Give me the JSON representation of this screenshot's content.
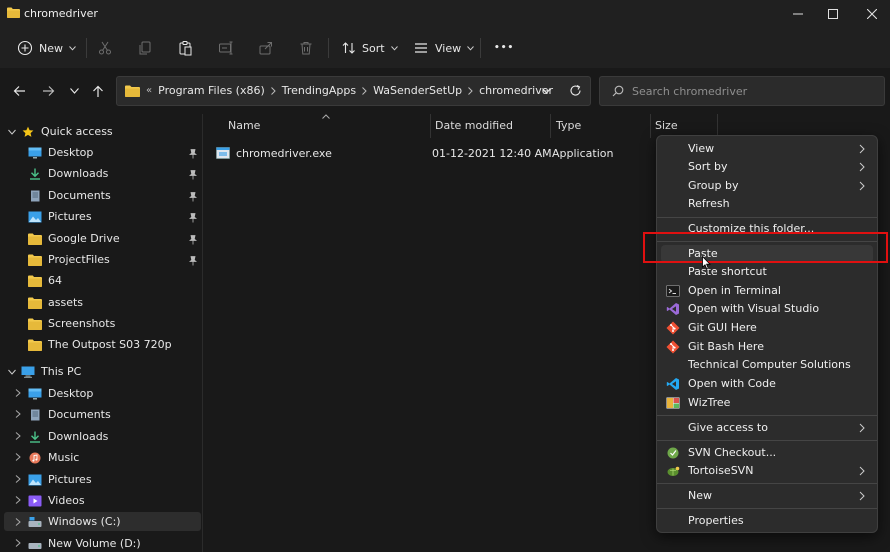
{
  "window": {
    "title": "chromedriver",
    "minimize_glyph": "—",
    "maximize_glyph": "☐",
    "close_glyph": "✕"
  },
  "commandbar": {
    "new_label": "New",
    "sort_label": "Sort",
    "view_label": "View",
    "more_glyph": "•••"
  },
  "address": {
    "overflow": "«",
    "crumbs": [
      "Program Files (x86)",
      "TrendingApps",
      "WaSenderSetUp",
      "chromedriver"
    ]
  },
  "search": {
    "placeholder": "Search chromedriver"
  },
  "sidebar": {
    "quick_access": "Quick access",
    "quick_items": [
      {
        "label": "Desktop",
        "icon": "desktop-icon",
        "pinned": true
      },
      {
        "label": "Downloads",
        "icon": "download-icon",
        "pinned": true
      },
      {
        "label": "Documents",
        "icon": "documents-icon",
        "pinned": true
      },
      {
        "label": "Pictures",
        "icon": "pictures-icon",
        "pinned": true
      },
      {
        "label": "Google Drive",
        "icon": "folder-icon",
        "pinned": true
      },
      {
        "label": "ProjectFiles",
        "icon": "folder-icon",
        "pinned": true
      },
      {
        "label": "64",
        "icon": "folder-icon",
        "pinned": false
      },
      {
        "label": "assets",
        "icon": "folder-icon",
        "pinned": false
      },
      {
        "label": "Screenshots",
        "icon": "folder-icon",
        "pinned": false
      },
      {
        "label": "The Outpost S03 720p",
        "icon": "folder-icon",
        "pinned": false
      }
    ],
    "this_pc": "This PC",
    "pc_items": [
      {
        "label": "Desktop",
        "icon": "desktop-icon"
      },
      {
        "label": "Documents",
        "icon": "documents-icon"
      },
      {
        "label": "Downloads",
        "icon": "download-icon"
      },
      {
        "label": "Music",
        "icon": "music-icon"
      },
      {
        "label": "Pictures",
        "icon": "pictures-icon"
      },
      {
        "label": "Videos",
        "icon": "videos-icon"
      },
      {
        "label": "Windows (C:)",
        "icon": "drive-icon"
      },
      {
        "label": "New Volume (D:)",
        "icon": "drive-icon"
      }
    ]
  },
  "filelist": {
    "columns": {
      "name": "Name",
      "date": "Date modified",
      "type": "Type",
      "size": "Size"
    },
    "files": [
      {
        "name": "chromedriver.exe",
        "date": "01-12-2021 12:40 AM",
        "type": "Application"
      }
    ]
  },
  "context_menu": {
    "items": [
      {
        "label": "View",
        "submenu": true
      },
      {
        "label": "Sort by",
        "submenu": true
      },
      {
        "label": "Group by",
        "submenu": true
      },
      {
        "label": "Refresh",
        "submenu": false
      },
      {
        "label": "Customize this folder...",
        "submenu": false
      },
      {
        "label": "Paste",
        "submenu": false
      },
      {
        "label": "Paste shortcut",
        "submenu": false
      },
      {
        "label": "Open in Terminal",
        "submenu": false,
        "icon": "terminal-icon"
      },
      {
        "label": "Open with Visual Studio",
        "submenu": false,
        "icon": "visual-studio-icon"
      },
      {
        "label": "Git GUI Here",
        "submenu": false,
        "icon": "git-icon"
      },
      {
        "label": "Git Bash Here",
        "submenu": false,
        "icon": "git-icon"
      },
      {
        "label": "Technical Computer Solutions",
        "submenu": false
      },
      {
        "label": "Open with Code",
        "submenu": false,
        "icon": "vscode-icon"
      },
      {
        "label": "WizTree",
        "submenu": false,
        "icon": "wiztree-icon"
      },
      {
        "label": "Give access to",
        "submenu": true
      },
      {
        "label": "SVN Checkout...",
        "submenu": false,
        "icon": "svn-icon"
      },
      {
        "label": "TortoiseSVN",
        "submenu": true,
        "icon": "tortoisesvn-icon"
      },
      {
        "label": "New",
        "submenu": true
      },
      {
        "label": "Properties",
        "submenu": false
      }
    ]
  },
  "colors": {
    "background": "#191919",
    "chrome": "#202020",
    "menu": "#2c2c2c",
    "folder": "#f2c94c",
    "highlight": "#e01010",
    "accent": "#3aa0e8"
  }
}
